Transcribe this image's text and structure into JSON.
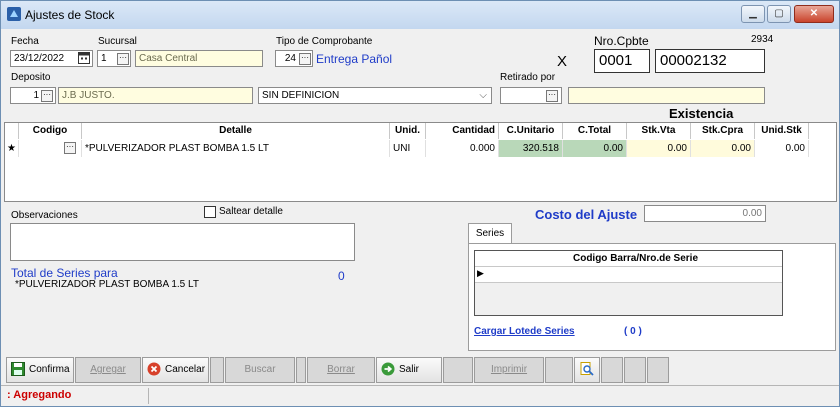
{
  "window": {
    "title": "Ajustes de Stock",
    "number": "2934"
  },
  "header": {
    "fecha_label": "Fecha",
    "fecha_value": "23/12/2022",
    "sucursal_label": "Sucursal",
    "sucursal_value": "1",
    "sucursal_name": "Casa Central",
    "tipo_label": "Tipo de Comprobante",
    "tipo_value": "24",
    "tipo_name": "Entrega Pañol",
    "nro_label": "Nro.Cpbte",
    "letra": "X",
    "nro_punto": "0001",
    "nro_numero": "00002132",
    "deposito_label": "Deposito",
    "deposito_value": "1",
    "deposito_name": "J.B JUSTO.",
    "definicion_value": "SIN DEFINICION",
    "retirado_label": "Retirado por"
  },
  "grid": {
    "group_label": "Existencia",
    "columns": [
      "Codigo",
      "Detalle",
      "Unid.",
      "Cantidad",
      "C.Unitario",
      "C.Total",
      "Stk.Vta",
      "Stk.Cpra",
      "Unid.Stk"
    ],
    "row": {
      "marker": "★",
      "codigo": "",
      "detalle": "*PULVERIZADOR PLAST BOMBA 1.5 LT",
      "unid": "UNI",
      "cantidad": "0.000",
      "c_unitario": "320.518",
      "c_total": "0.00",
      "stk_vta": "0.00",
      "stk_cpra": "0.00",
      "unid_stk": "0.00"
    }
  },
  "observaciones": {
    "label": "Observaciones",
    "saltear_label": "Saltear detalle"
  },
  "costo": {
    "label": "Costo del Ajuste",
    "value": "0.00"
  },
  "series": {
    "tab_label": "Series",
    "column": "Codigo Barra/Nro.de Serie",
    "total_label": "Total de Series para",
    "total_item": "*PULVERIZADOR PLAST BOMBA 1.5 LT",
    "total_count": "0",
    "cargar_label": "Cargar Lotede Series",
    "cargar_count": "( 0 )"
  },
  "toolbar": {
    "confirma": "Confirma",
    "agregar": "Agregar",
    "cancelar": "Cancelar",
    "buscar": "Buscar",
    "borrar": "Borrar",
    "salir": "Salir",
    "imprimir": "Imprimir"
  },
  "status": {
    "text": ": Agregando"
  },
  "colors": {
    "accent_blue": "#1f3cc8",
    "status_red": "#cc0000",
    "green_cell": "#b9d8b9",
    "yellow_field": "#fffde0"
  }
}
